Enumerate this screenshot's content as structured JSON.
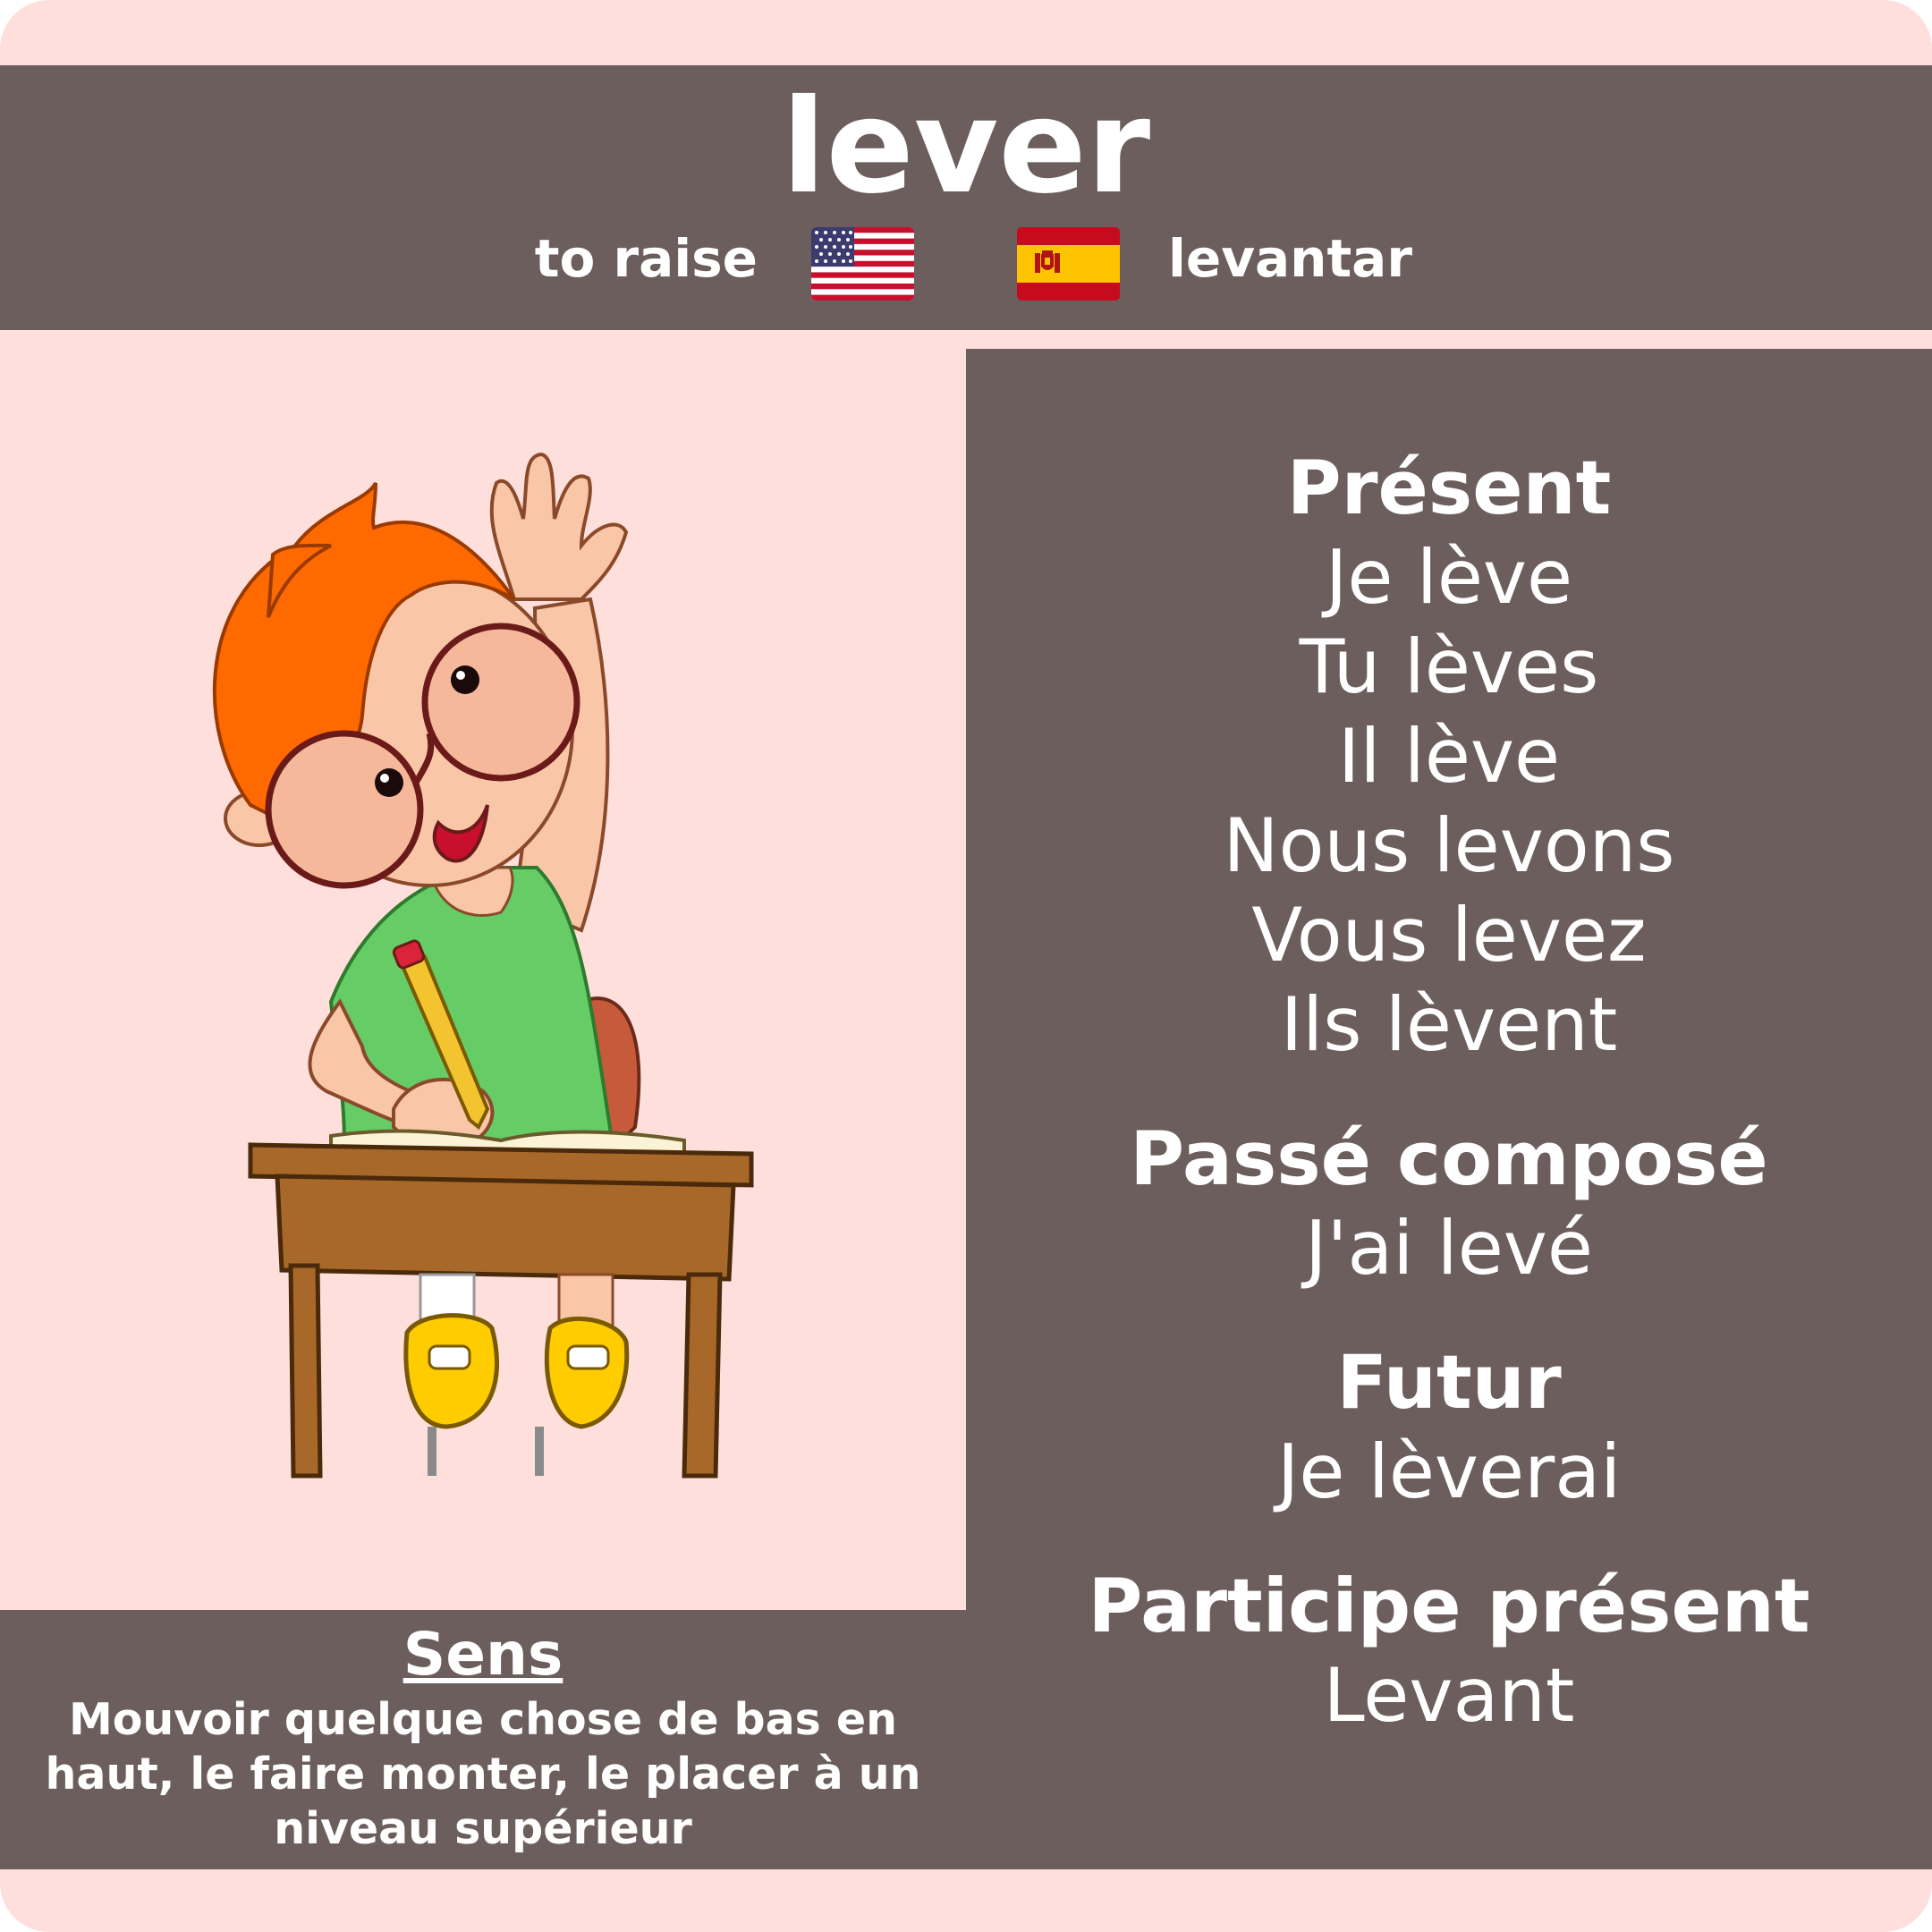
{
  "verb": "lever",
  "translations": {
    "english": "to raise",
    "spanish": "levantar"
  },
  "flags": {
    "english": "us-flag-icon",
    "spanish": "spain-flag-icon"
  },
  "illustration": "child-raising-hand-at-desk",
  "conjugations": {
    "present": {
      "label": "Présent",
      "forms": [
        "Je lève",
        "Tu lèves",
        "Il lève",
        "Nous levons",
        "Vous levez",
        "Ils lèvent"
      ]
    },
    "passe_compose": {
      "label": "Passé composé",
      "form": "J'ai levé"
    },
    "futur": {
      "label": "Futur",
      "form": "Je lèverai"
    },
    "participe_present": {
      "label": "Participe présent",
      "form": "Levant"
    }
  },
  "sens": {
    "title": "Sens",
    "text": "Mouvoir quelque chose de bas en haut, le faire monter, le placer à un niveau supérieur"
  },
  "colors": {
    "background": "#ffdfdc",
    "panel": "#6b5e5d",
    "text": "#ffffff"
  }
}
